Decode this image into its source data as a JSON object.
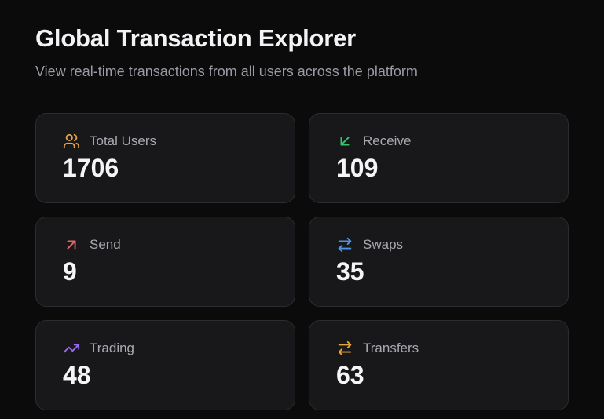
{
  "header": {
    "title": "Global Transaction Explorer",
    "subtitle": "View real-time transactions from all users across the platform"
  },
  "stats": [
    {
      "label": "Total Users",
      "value": "1706",
      "icon": "users-icon",
      "color": "#e5a44a"
    },
    {
      "label": "Receive",
      "value": "109",
      "icon": "arrow-down-left-icon",
      "color": "#36c46b"
    },
    {
      "label": "Send",
      "value": "9",
      "icon": "arrow-up-right-icon",
      "color": "#e8686a"
    },
    {
      "label": "Swaps",
      "value": "35",
      "icon": "swap-arrows-icon",
      "color": "#4e93e6"
    },
    {
      "label": "Trading",
      "value": "48",
      "icon": "trending-up-icon",
      "color": "#9a6bf0"
    },
    {
      "label": "Transfers",
      "value": "63",
      "icon": "transfer-arrows-icon",
      "color": "#e5a33a"
    }
  ]
}
